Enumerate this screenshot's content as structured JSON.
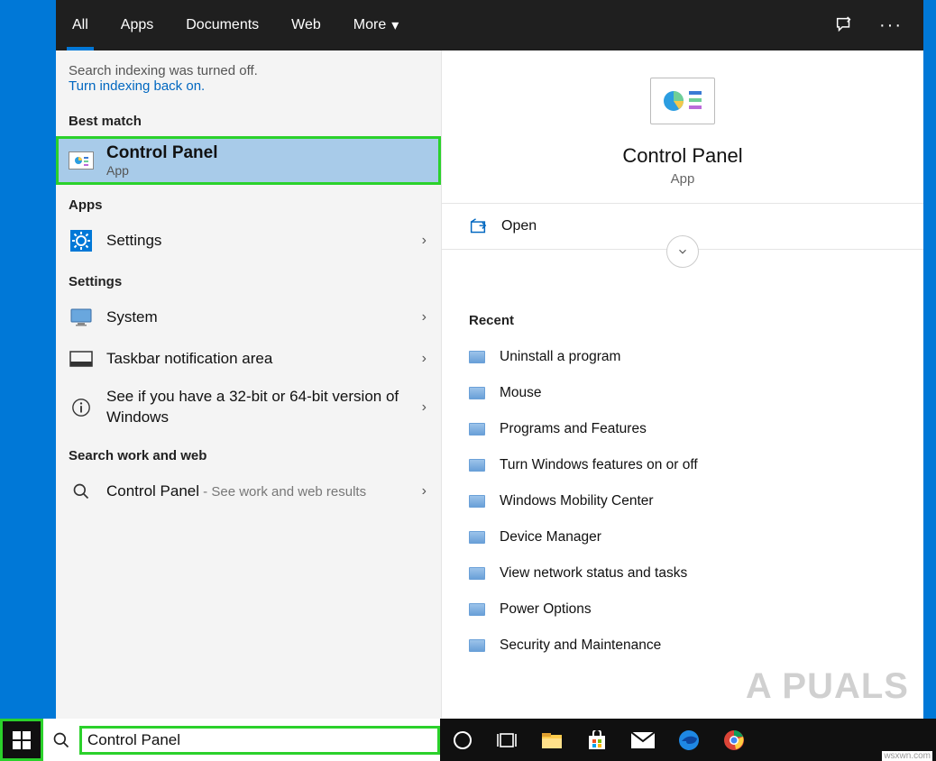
{
  "tabs": {
    "all": "All",
    "apps": "Apps",
    "documents": "Documents",
    "web": "Web",
    "more": "More"
  },
  "notice": {
    "text": "Search indexing was turned off.",
    "link": "Turn indexing back on."
  },
  "sections": {
    "best_match": "Best match",
    "apps": "Apps",
    "settings": "Settings",
    "search_web": "Search work and web"
  },
  "best_match": {
    "title": "Control Panel",
    "subtitle": "App"
  },
  "apps_results": [
    {
      "title": "Settings"
    }
  ],
  "settings_results": [
    {
      "title": "System"
    },
    {
      "title": "Taskbar notification area"
    },
    {
      "title": "See if you have a 32-bit or 64-bit version of Windows"
    }
  ],
  "web_result": {
    "query": "Control Panel",
    "suffix": " - See work and web results"
  },
  "preview": {
    "title": "Control Panel",
    "subtitle": "App",
    "open": "Open",
    "recent_header": "Recent",
    "recent": [
      "Uninstall a program",
      "Mouse",
      "Programs and Features",
      "Turn Windows features on or off",
      "Windows Mobility Center",
      "Device Manager",
      "View network status and tasks",
      "Power Options",
      "Security and Maintenance"
    ]
  },
  "search_value": "Control Panel",
  "watermark": "A  PUALS",
  "credit": "wsxwn.com"
}
